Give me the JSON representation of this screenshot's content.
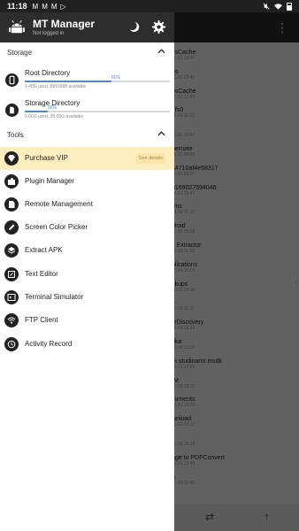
{
  "status_bar": {
    "time": "11:18",
    "notifications": [
      "M",
      "M",
      "M",
      "▷"
    ]
  },
  "app": {
    "title": "MT Manager",
    "subtitle": "Not logged in"
  },
  "sections": {
    "storage": {
      "label": "Storage"
    },
    "tools": {
      "label": "Tools"
    }
  },
  "storage_items": [
    {
      "name": "Root Directory",
      "percent": "60%",
      "percent_value": 60,
      "used": "1.48G used, 999.50M available"
    },
    {
      "name": "Storage Directory",
      "percent": "16%",
      "percent_value": 16,
      "used": "5.66G used, 28.65G available"
    }
  ],
  "tools": [
    {
      "name": "Purchase VIP",
      "badge": "See details",
      "icon": "diamond-icon"
    },
    {
      "name": "Plugin Manager",
      "icon": "puzzle-icon"
    },
    {
      "name": "Remote Management",
      "icon": "document-icon"
    },
    {
      "name": "Screen Color Picker",
      "icon": "pen-icon"
    },
    {
      "name": "Extract APK",
      "icon": "layers-icon"
    },
    {
      "name": "Text Editor",
      "icon": "edit-icon"
    },
    {
      "name": "Terminal Simulator",
      "icon": "terminal-icon"
    },
    {
      "name": "FTP Client",
      "icon": "wifi-icon"
    },
    {
      "name": "Activity Record",
      "icon": "clock-icon"
    }
  ],
  "background_files": [
    {
      "name": "ysCache",
      "date": "11-21 12:47"
    },
    {
      "name": "ps",
      "date": "11-21 12:47"
    },
    {
      "name": "psCache",
      "date": "11-21 12:47"
    },
    {
      "name": "_fs0",
      "date": "11-19 11:22"
    },
    {
      "name": "s",
      "date": "11-21 12:47"
    },
    {
      "name": "bernate",
      "date": "11-21 06:28"
    },
    {
      "name": "a4710af4e58317",
      "date": "11-21 06:27"
    },
    {
      "name": "9169027594046",
      "date": "11-21 12:47"
    },
    {
      "name": "rms",
      "date": "11-19 11:37"
    },
    {
      "name": "droid",
      "date": "11-19 08:28"
    },
    {
      "name": "k Extractor",
      "date": "11-19 11:10"
    },
    {
      "name": "plications",
      "date": "11-19 11:14"
    },
    {
      "name": "ckups",
      "date": "11-21 10:10"
    },
    {
      "name": "e",
      "date": "11-19 11:37"
    },
    {
      "name": "leDiscovery",
      "date": "11-19 13:13"
    },
    {
      "name": "dka",
      "date": "11-19 10:35"
    },
    {
      "name": "m.studioarm.msdk",
      "date": "11-21 17:52"
    },
    {
      "name": "IM",
      "date": "11-19 10:31"
    },
    {
      "name": "cuments",
      "date": "11-21 14:20"
    },
    {
      "name": "wnload",
      "date": "11-21 09:17"
    },
    {
      "name": "li",
      "date": "11-18 16:34"
    },
    {
      "name": "age to PDFConvert",
      "date": "11-21 12:48"
    },
    {
      "name": "g",
      "date": "11-19 11:40"
    }
  ]
}
